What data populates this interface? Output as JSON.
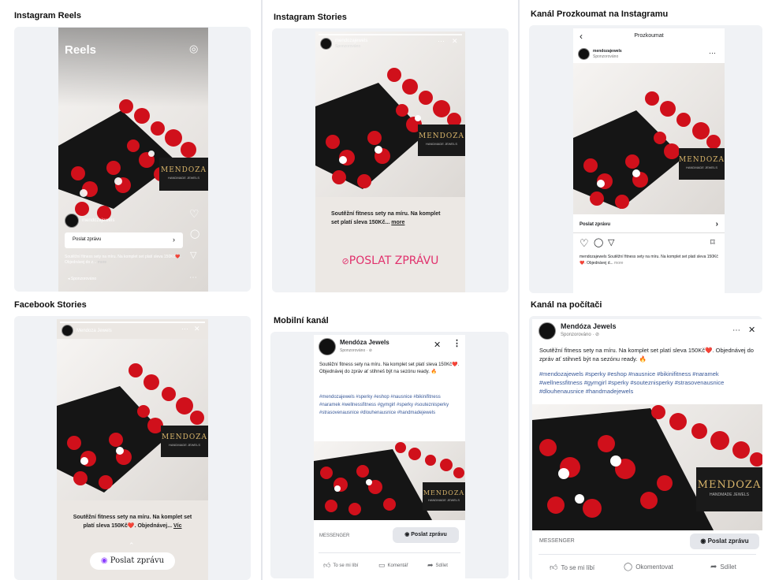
{
  "sections": {
    "reels": {
      "title": "Instagram Reels",
      "header_label": "Reels",
      "account": "mendozajewels",
      "cta": "Poslat zprávu",
      "caption": "Soutěžní fitness sety na míru. Na komplet set platí sleva 150Kč❤️. Objednávej do z...",
      "more": "more",
      "sponsored": "Sponzorováno"
    },
    "stories": {
      "title": "Instagram Stories",
      "account": "mendozajewels",
      "sponsored": "Sponzorováno",
      "caption": "Soutěžní fitness sety na míru. Na komplet set platí sleva 150Kč...",
      "more": "more",
      "cta": "POSLAT ZPRÁVU"
    },
    "explore": {
      "title": "Kanál Prozkoumat na Instagramu",
      "header_label": "Prozkoumat",
      "account": "mendozajewels",
      "sponsored": "Sponzorováno",
      "cta": "Poslat zprávu",
      "caption": "mendozajewels Soutěžní fitness sety na míru. Na komplet set platí sleva 150Kč❤️. Objednávej d...",
      "more": "more"
    },
    "fb_stories": {
      "title": "Facebook Stories",
      "account": "Mendoza Jewels",
      "caption": "Soutěžní fitness sety na míru. Na komplet set platí sleva 150Kč❤️. Objednávej...",
      "more": "Víc",
      "cta": "Poslat zprávu"
    },
    "mobile": {
      "title": "Mobilní kanál",
      "page_name": "Mendóza Jewels",
      "sponsored": "Sponzorováno · ⊘",
      "text": "Soutěžní fitness sety na míru. Na komplet set platí sleva 150Kč❤️. Objednávej do zpráv ať stihneš být na sezónu ready. 🔥",
      "hashtags": "#mendozajewels #sperky #eshop #nausnice #bikinifitness #naramek #wellnessfitness #gymgirl #sperky #souteznisperky #strasovenausnice #dlouhenausnice #handmadejewels",
      "messenger": "MESSENGER",
      "cta": "Poslat zprávu",
      "like": "To se mi líbí",
      "comment": "Komentář",
      "share": "Sdílet"
    },
    "desktop": {
      "title": "Kanál na počítači",
      "page_name": "Mendóza Jewels",
      "sponsored": "Sponzorováno · ⊘",
      "text": "Soutěžní fitness sety na míru. Na komplet set platí sleva 150Kč❤️. Objednávej do zpráv ať stihneš být na sezónu ready. 🔥",
      "hashtags": "#mendozajewels #sperky #eshop #nausnice #bikinifitness #naramek #wellnessfitness #gymgirl #sperky #souteznisperky #strasovenausnice #dlouhenausnice #handmadejewels",
      "messenger": "MESSENGER",
      "cta": "Poslat zprávu",
      "like": "To se mi líbí",
      "comment": "Okomentovat",
      "share": "Sdílet"
    }
  },
  "brand": {
    "logo_main": "MENDOZA",
    "logo_sub": "HANDMADE JEWELS"
  },
  "colors": {
    "jewel_red": "#d0101b",
    "box_black": "#151515",
    "link_blue": "#385898",
    "gold": "#d8b46a"
  },
  "icons": {
    "heart": "♡",
    "comment": "◯",
    "send": "▽",
    "bookmark": "⌑",
    "camera": "◎",
    "close": "✕",
    "more": "⋯"
  }
}
